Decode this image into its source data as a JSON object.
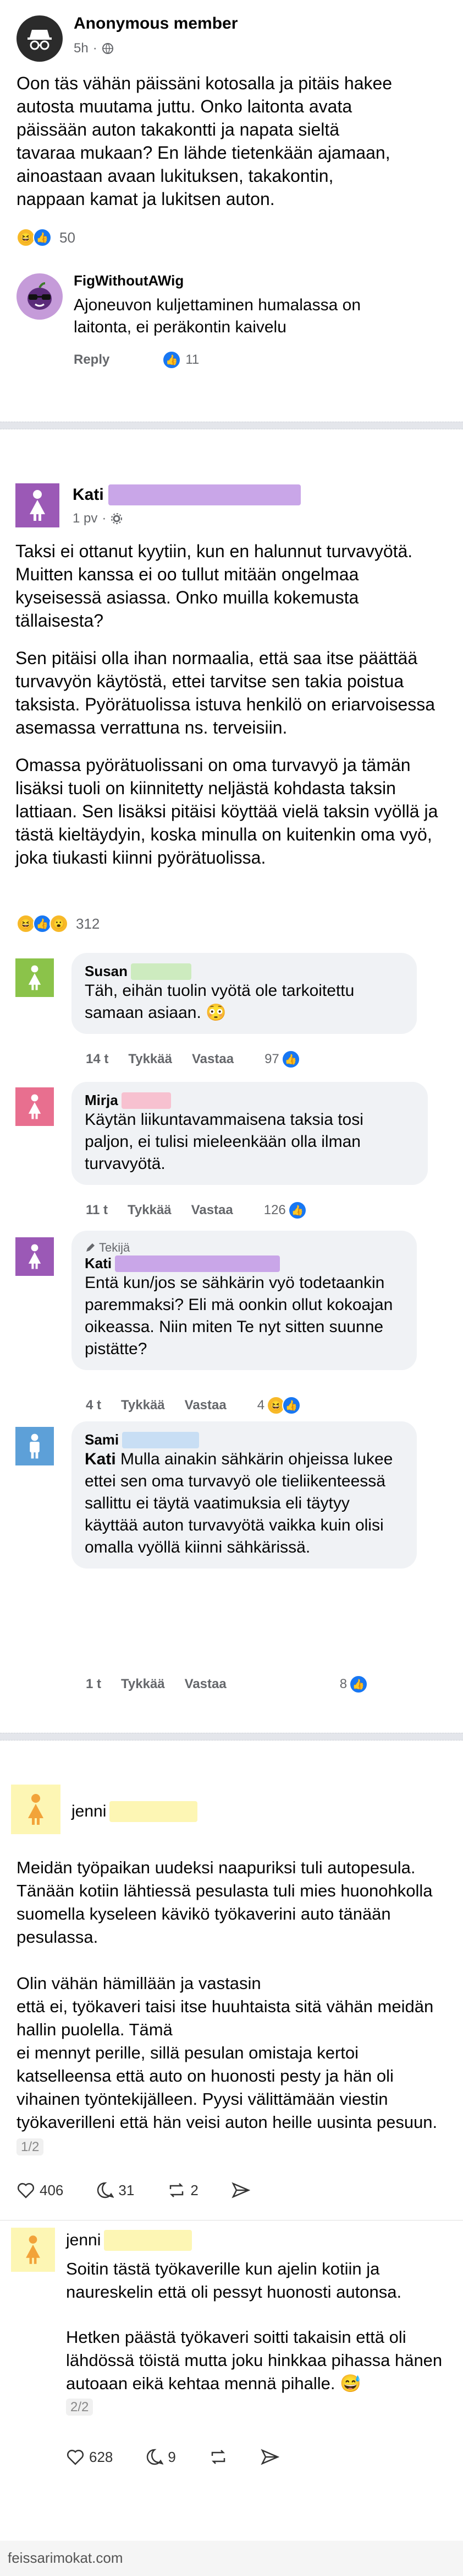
{
  "post1": {
    "author": "Anonymous member",
    "time": "5h",
    "text": "Oon täs vähän päissäni kotosalla ja pitäis hakee autosta muutama juttu. Onko laitonta avata päissään auton takakontti ja napata sieltä tavaraa mukaan? En lähde tietenkään ajamaan, ainoastaan avaan lukituksen, takakontin, nappaan kamat ja lukitsen auton.",
    "reaction_count": "50",
    "comment": {
      "author": "FigWithoutAWig",
      "text": "Ajoneuvon kuljettaminen humalassa on laitonta, ei peräkontin kaivelu",
      "reply": "Reply",
      "likes": "11"
    }
  },
  "post2": {
    "author": "Kati",
    "time": "1 pv",
    "paragraphs": [
      "Taksi ei ottanut kyytiin, kun en halunnut turvavyötä. Muitten kanssa ei oo tullut mitään ongelmaa kyseisessä asiassa. Onko muilla kokemusta tällaisesta?",
      "Sen pitäisi olla ihan normaalia, että saa itse päättää turvavyön käytöstä, ettei tarvitse sen takia poistua taksista. Pyörätuolissa istuva henkilö on eriarvoisessa asemassa verrattuna ns. terveisiin.",
      "Omassa pyörätuolissani on oma turvavyö ja tämän lisäksi tuoli on kiinnitetty neljästä kohdasta taksin lattiaan. Sen lisäksi pitäisi köyttää vielä taksin vyöllä ja tästä kieltäydyin, koska minulla on kuitenkin oma vyö, joka tiukasti kiinni pyörätuolissa."
    ],
    "reaction_count": "312",
    "comments": [
      {
        "author": "Susan",
        "text": "Täh, eihän tuolin vyötä ole tarkoitettu samaan asiaan. 😳",
        "time": "14 t",
        "like": "Tykkää",
        "reply": "Vastaa",
        "count": "97"
      },
      {
        "author": "Mirja",
        "text": "Käytän liikuntavammaisena taksia tosi paljon, ei tulisi mieleenkään olla ilman turvavyötä.",
        "time": "11 t",
        "like": "Tykkää",
        "reply": "Vastaa",
        "count": "126"
      },
      {
        "author": "Kati",
        "badge": "Tekijä",
        "text": "Entä kun/jos se sähkärin vyö todetaankin paremmaksi? Eli mä oonkin ollut kokoajan oikeassa. Niin miten Te nyt sitten suunne pistätte?",
        "time": "4 t",
        "like": "Tykkää",
        "reply": "Vastaa",
        "count": "4"
      },
      {
        "author": "Sami",
        "mention": "Kati",
        "text": "Mulla ainakin sähkärin ohjeissa lukee ettei sen oma turvavyö ole tieliikenteessä sallittu ei täytä vaatimuksia eli täytyy käyttää auton turvavyötä vaikka kuin olisi omalla vyöllä kiinni sähkärissä.",
        "time": "1 t",
        "like": "Tykkää",
        "reply": "Vastaa",
        "count": "8"
      }
    ]
  },
  "post3": {
    "author": "jenni",
    "paragraphs": [
      "Meidän työpaikan uudeksi naapuriksi tuli autopesula. Tänään kotiin lähtiessä pesulasta tuli mies huonohkolla suomella kyseleen kävikö työkaverini auto tänään pesulassa.",
      "Olin vähän hämillään ja vastasin\nettä ei, työkaveri taisi itse huuhtaista sitä vähän meidän hallin puolella. Tämä\nei mennyt perille, sillä pesulan omistaja kertoi katselleensa että auto on huonosti pesty ja hän oli vihainen työntekijälleen. Pyysi välittämään viestin työkaverilleni että hän veisi auton heille uusinta pesuun."
    ],
    "thread_pos": "1/2",
    "stats": {
      "likes": "406",
      "replies": "31",
      "reposts": "2"
    },
    "reply": {
      "author": "jenni",
      "paragraphs": [
        "Soitin tästä työkaverille kun ajelin kotiin ja naureskelin että oli pessyt huonosti autonsa.",
        "Hetken päästä työkaveri soitti takaisin että oli lähdössä töistä mutta joku hinkkaa pihassa hänen autoaan eikä kehtaa mennä pihalle. 😅"
      ],
      "thread_pos": "2/2",
      "stats": {
        "likes": "628",
        "replies": "9",
        "reposts": ""
      }
    }
  },
  "watermark": "feissarimokat.com",
  "colors": {
    "like": "#1877f2",
    "blur_purple": "#c9a6e8",
    "blur_green": "#cdebbf",
    "blur_pink": "#f7c1d0",
    "blur_blue": "#c8def4",
    "blur_yellow": "#fdf6b4"
  }
}
